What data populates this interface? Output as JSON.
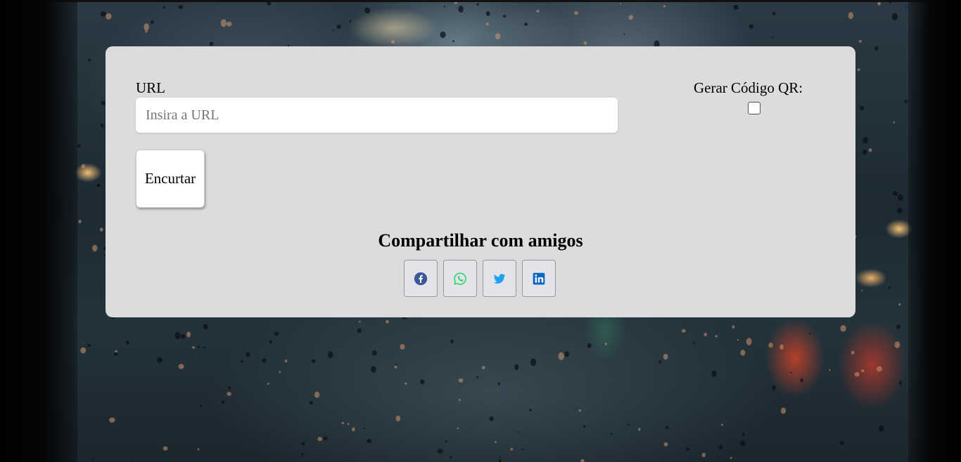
{
  "form": {
    "url_label": "URL",
    "url_placeholder": "Insira a URL",
    "url_value": "",
    "qr_label": "Gerar Código QR:",
    "qr_checked": false,
    "shorten_label": "Encurtar"
  },
  "share": {
    "title": "Compartilhar com amigos",
    "buttons": [
      {
        "name": "facebook",
        "icon": "facebook-icon",
        "color": "#3b5998"
      },
      {
        "name": "whatsapp",
        "icon": "whatsapp-icon",
        "color": "#25d366"
      },
      {
        "name": "twitter",
        "icon": "twitter-icon",
        "color": "#1da1f2"
      },
      {
        "name": "linkedin",
        "icon": "linkedin-icon",
        "color": "#0a66c2"
      }
    ]
  },
  "colors": {
    "card_background": "#dcdcdc"
  }
}
